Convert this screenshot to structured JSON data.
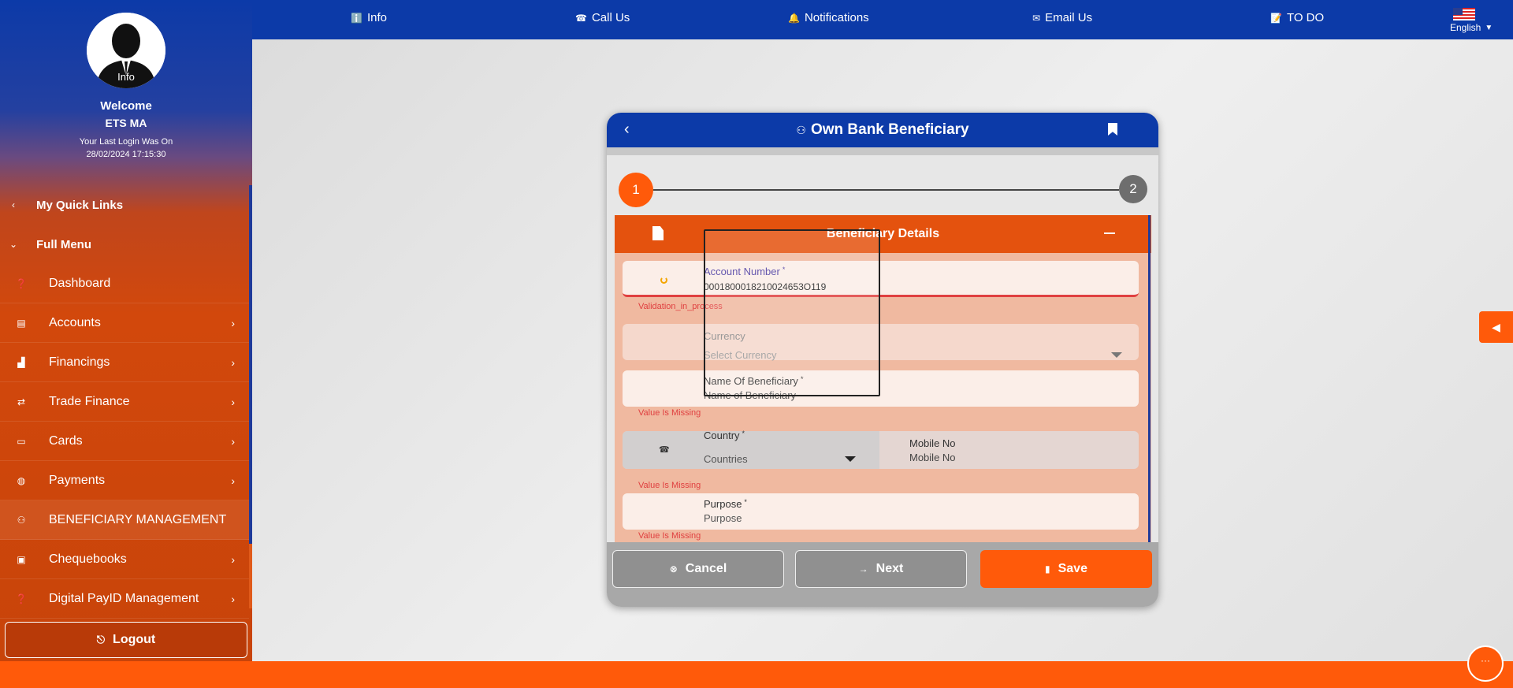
{
  "sidebar": {
    "avatar_label": "Info",
    "welcome": "Welcome",
    "username": "ETS MA",
    "last_login_label": "Your Last Login Was On",
    "last_login_value": "28/02/2024 17:15:30",
    "quick_links": "My Quick Links",
    "full_menu": "Full Menu",
    "items": [
      {
        "label": "Dashboard",
        "icon": "help-circle-icon",
        "has_submenu": false
      },
      {
        "label": "Accounts",
        "icon": "accounts-icon",
        "has_submenu": true
      },
      {
        "label": "Financings",
        "icon": "chart-icon",
        "has_submenu": true
      },
      {
        "label": "Trade Finance",
        "icon": "trade-icon",
        "has_submenu": true
      },
      {
        "label": "Cards",
        "icon": "card-icon",
        "has_submenu": true
      },
      {
        "label": "Payments",
        "icon": "payments-icon",
        "has_submenu": true
      },
      {
        "label": "BENEFICIARY MANAGEMENT",
        "icon": "beneficiary-icon",
        "has_submenu": false,
        "active": true
      },
      {
        "label": "Chequebooks",
        "icon": "chequebook-icon",
        "has_submenu": true
      },
      {
        "label": "Digital PayID Management",
        "icon": "help-circle-icon",
        "has_submenu": true
      }
    ],
    "logout": "Logout"
  },
  "topbar": {
    "items": [
      {
        "label": "Info",
        "icon": "info-icon"
      },
      {
        "label": "Call Us",
        "icon": "call-icon"
      },
      {
        "label": "Notifications",
        "icon": "bell-icon"
      },
      {
        "label": "Email Us",
        "icon": "email-icon"
      },
      {
        "label": "TO DO",
        "icon": "todo-icon"
      }
    ],
    "language": "English"
  },
  "modal": {
    "title": "Own Bank Beneficiary",
    "step_current": "1",
    "step_next": "2",
    "panel_title": "Beneficiary Details",
    "fields": {
      "account_number": {
        "label": "Account Number",
        "value": "0001800018210024653O119",
        "error": "Validation_in_process"
      },
      "currency": {
        "label": "Currency",
        "placeholder": "Select Currency"
      },
      "beneficiary_name": {
        "label": "Name Of Beneficiary",
        "placeholder": "Name of Beneficiary",
        "error": "Value Is Missing"
      },
      "country": {
        "label": "Country",
        "placeholder": "Countries",
        "error": "Value Is Missing"
      },
      "mobile": {
        "label": "Mobile No",
        "placeholder": "Mobile No"
      },
      "purpose": {
        "label": "Purpose",
        "placeholder": "Purpose",
        "error": "Value Is Missing"
      }
    },
    "buttons": {
      "cancel": "Cancel",
      "next": "Next",
      "save": "Save"
    }
  },
  "colors": {
    "primary": "#0c3aa8",
    "accent": "#ff5a0a",
    "error": "#e04040"
  }
}
